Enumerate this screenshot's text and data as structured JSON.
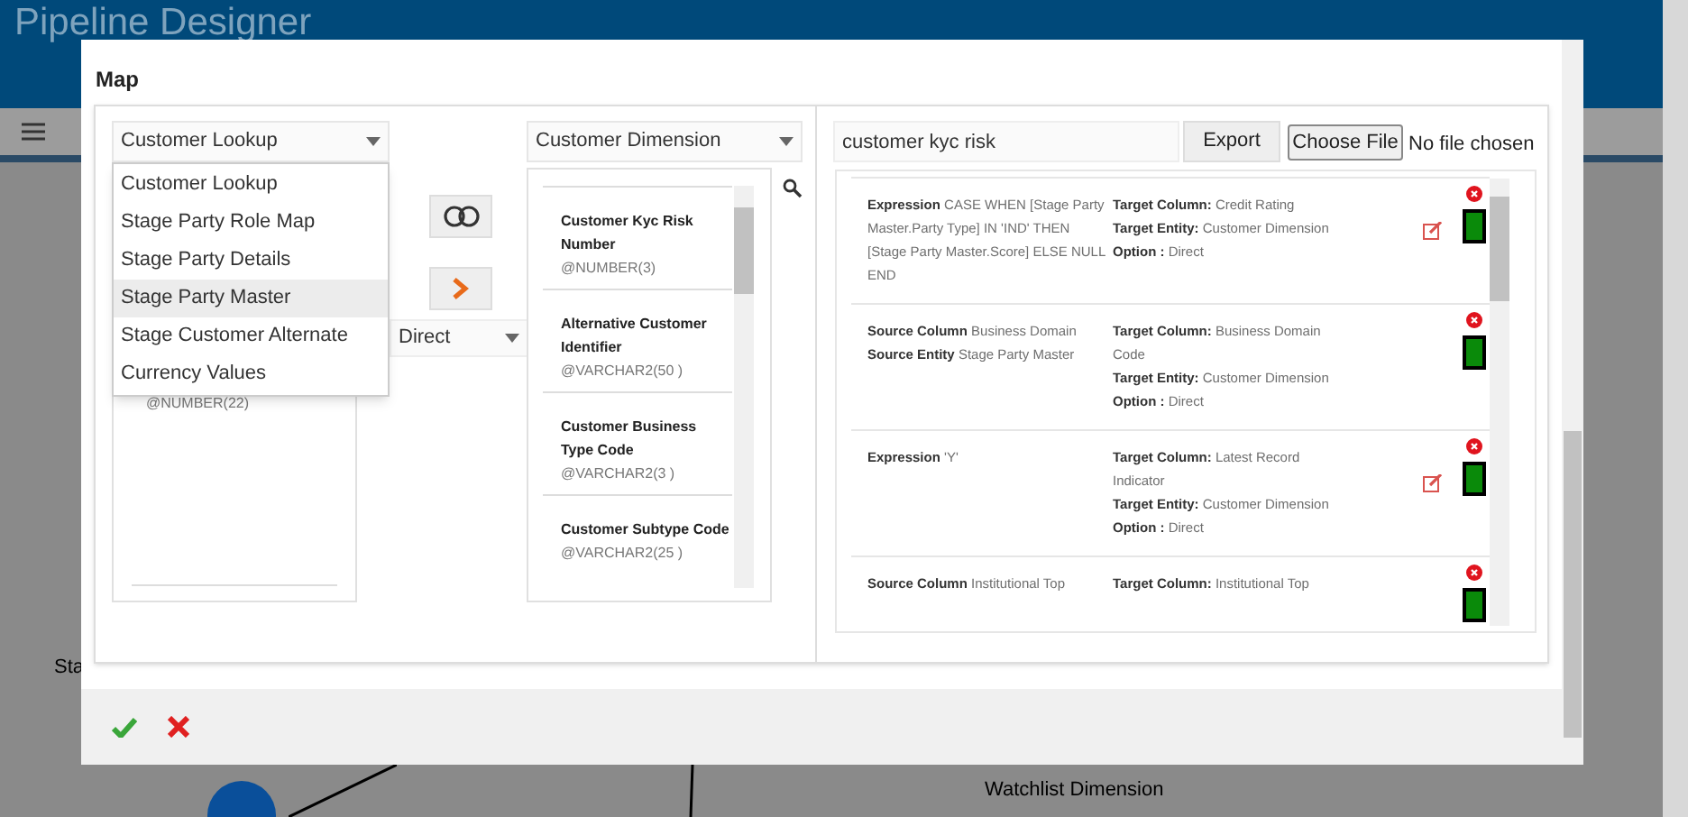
{
  "app": {
    "title": "Pipeline Designer",
    "nodes": [
      {
        "label": "Sta"
      },
      {
        "label": "Watchlist Dimension"
      }
    ]
  },
  "modal": {
    "title": "Map",
    "source_select": {
      "value": "Customer Lookup"
    },
    "source_options": [
      {
        "label": "Customer Lookup",
        "selected": false
      },
      {
        "label": "Stage Party Role Map",
        "selected": false
      },
      {
        "label": "Stage Party Details",
        "selected": false
      },
      {
        "label": "Stage Party Master",
        "selected": true
      },
      {
        "label": "Stage Customer Alternate",
        "selected": false
      },
      {
        "label": "Currency Values",
        "selected": false
      }
    ],
    "source_columns": [
      {
        "type": "@NUMBER(22)"
      }
    ],
    "option_select": {
      "value": "Direct"
    },
    "target_select": {
      "value": "Customer Dimension"
    },
    "target_columns": [
      {
        "name": "Customer Kyc Risk Number",
        "type": "@NUMBER(3)"
      },
      {
        "name": "Alternative Customer Identifier",
        "type": "@VARCHAR2(50 )"
      },
      {
        "name": "Customer Business Type Code",
        "type": "@VARCHAR2(3 )"
      },
      {
        "name": "Customer Subtype Code",
        "type": "@VARCHAR2(25 )"
      }
    ],
    "search": {
      "value": "customer kyc risk"
    },
    "export_button": "Export",
    "file_button": "Choose File",
    "file_status": "No file chosen",
    "mappings": [
      {
        "left": [
          {
            "label": "Expression",
            "value": "CASE WHEN [Stage Party Master.Party Type] IN 'IND' THEN [Stage Party Master.Score] ELSE NULL END"
          }
        ],
        "right": [
          {
            "label": "Target Column:",
            "value": "Credit Rating"
          },
          {
            "label": "Target Entity:",
            "value": "Customer Dimension"
          },
          {
            "label": "Option :",
            "value": "Direct"
          }
        ],
        "editable": true,
        "active": true
      },
      {
        "left": [
          {
            "label": "Source Column",
            "value": "Business Domain"
          },
          {
            "label": "Source Entity",
            "value": "Stage Party Master"
          }
        ],
        "right": [
          {
            "label": "Target Column:",
            "value": "Business Domain Code"
          },
          {
            "label": "Target Entity:",
            "value": "Customer Dimension"
          },
          {
            "label": "Option :",
            "value": "Direct"
          }
        ],
        "editable": false,
        "active": true
      },
      {
        "left": [
          {
            "label": "Expression",
            "value": "'Y'"
          }
        ],
        "right": [
          {
            "label": "Target Column:",
            "value": "Latest Record Indicator"
          },
          {
            "label": "Target Entity:",
            "value": "Customer Dimension"
          },
          {
            "label": "Option :",
            "value": "Direct"
          }
        ],
        "editable": true,
        "active": true
      },
      {
        "left": [
          {
            "label": "Source Column",
            "value": "Institutional Top"
          }
        ],
        "right": [
          {
            "label": "Target Column:",
            "value": "Institutional Top"
          }
        ],
        "editable": false,
        "active": true
      }
    ]
  }
}
